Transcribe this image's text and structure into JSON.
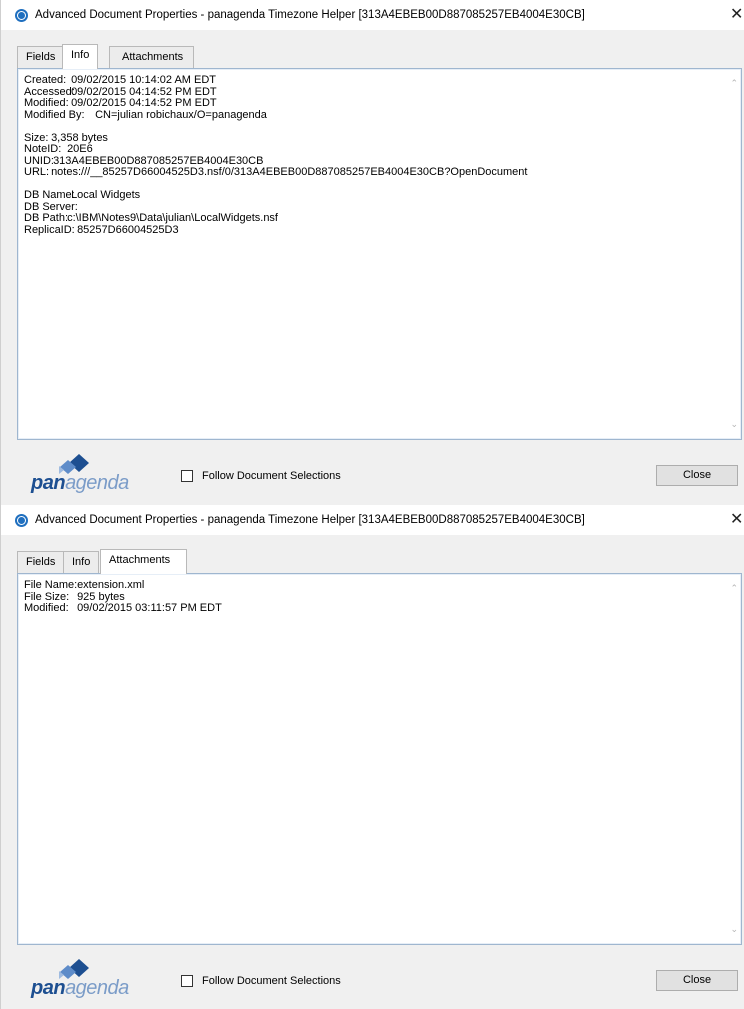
{
  "windows": [
    {
      "title": "Advanced Document Properties - panagenda Timezone Helper [313A4EBEB00D887085257EB4004E30CB]",
      "close_glyph": "✕",
      "tabs": [
        {
          "label": "Fields"
        },
        {
          "label": "Info"
        },
        {
          "label": "Attachments"
        }
      ],
      "active_tab": "Info",
      "content_lines": [
        {
          "label": "Created:",
          "value": "09/02/2015 10:14:02 AM EDT"
        },
        {
          "label": "Accessed:",
          "value": "09/02/2015 04:14:52 PM EDT"
        },
        {
          "label": "Modified:",
          "value": "09/02/2015 04:14:52 PM EDT"
        },
        {
          "label": "Modified By:",
          "value": "CN=julian robichaux/O=panagenda"
        },
        {
          "label": "",
          "value": ""
        },
        {
          "label": "Size:",
          "value": "3,358 bytes"
        },
        {
          "label": "NoteID:",
          "value": "20E6"
        },
        {
          "label": "UNID:",
          "value": "313A4EBEB00D887085257EB4004E30CB"
        },
        {
          "label": "URL:",
          "value": "notes:///__85257D66004525D3.nsf/0/313A4EBEB00D887085257EB4004E30CB?OpenDocument"
        },
        {
          "label": "",
          "value": ""
        },
        {
          "label": "DB Name:",
          "value": "Local Widgets"
        },
        {
          "label": "DB Server:",
          "value": ""
        },
        {
          "label": "DB Path:",
          "value": "c:\\IBM\\Notes9\\Data\\julian\\LocalWidgets.nsf"
        },
        {
          "label": "ReplicaID:",
          "value": "85257D66004525D3"
        }
      ],
      "follow_label": "Follow Document Selections",
      "follow_checked": false,
      "close_button": "Close",
      "logo": {
        "part1": "pan",
        "part2": "agenda"
      }
    },
    {
      "title": "Advanced Document Properties - panagenda Timezone Helper [313A4EBEB00D887085257EB4004E30CB]",
      "close_glyph": "✕",
      "tabs": [
        {
          "label": "Fields"
        },
        {
          "label": "Info"
        },
        {
          "label": "Attachments"
        }
      ],
      "active_tab": "Attachments",
      "content_lines": [
        {
          "label": "File Name:",
          "value": "extension.xml"
        },
        {
          "label": "File Size:",
          "value": "925 bytes"
        },
        {
          "label": "Modified:",
          "value": "09/02/2015 03:11:57 PM EDT"
        }
      ],
      "follow_label": "Follow Document Selections",
      "follow_checked": false,
      "close_button": "Close",
      "logo": {
        "part1": "pan",
        "part2": "agenda"
      }
    }
  ],
  "colors": {
    "logo_dark": "#1d4f91",
    "logo_light": "#7b9cc8",
    "panel_border": "#9fb6cf"
  }
}
